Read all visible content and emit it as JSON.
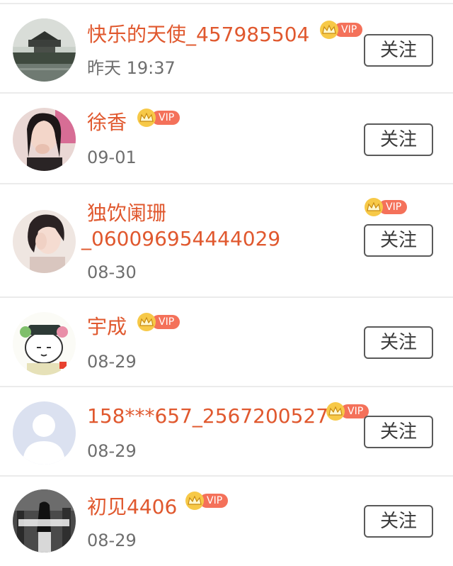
{
  "users": [
    {
      "name": "快乐的天使_457985504",
      "time": "昨天 19:37",
      "vip_label": "VIP",
      "follow_label": "关注",
      "avatar": "avatar-pagoda-landscape"
    },
    {
      "name": "徐香",
      "time": "09-01",
      "vip_label": "VIP",
      "follow_label": "关注",
      "avatar": "avatar-woman-portrait"
    },
    {
      "name_line1": "独饮阑珊",
      "name_line2": "_060096954444029",
      "time": "08-30",
      "vip_label": "VIP",
      "follow_label": "关注",
      "avatar": "avatar-woman-portrait"
    },
    {
      "name": "宇成",
      "time": "08-29",
      "vip_label": "VIP",
      "follow_label": "关注",
      "avatar": "avatar-cartoon"
    },
    {
      "name": "158***657_2567200527",
      "time": "08-29",
      "vip_label": "VIP",
      "follow_label": "关注",
      "avatar": "avatar-default-person"
    },
    {
      "name": "初见4406",
      "time": "08-29",
      "vip_label": "VIP",
      "follow_label": "关注",
      "avatar": "avatar-dark-photo"
    }
  ],
  "colors": {
    "name": "#e0582e",
    "time": "#6e6e6e",
    "vip_crown": "#f7c948",
    "vip_tag": "#f4715a",
    "divider": "#ebebeb",
    "button_border": "#5a5a5a"
  }
}
